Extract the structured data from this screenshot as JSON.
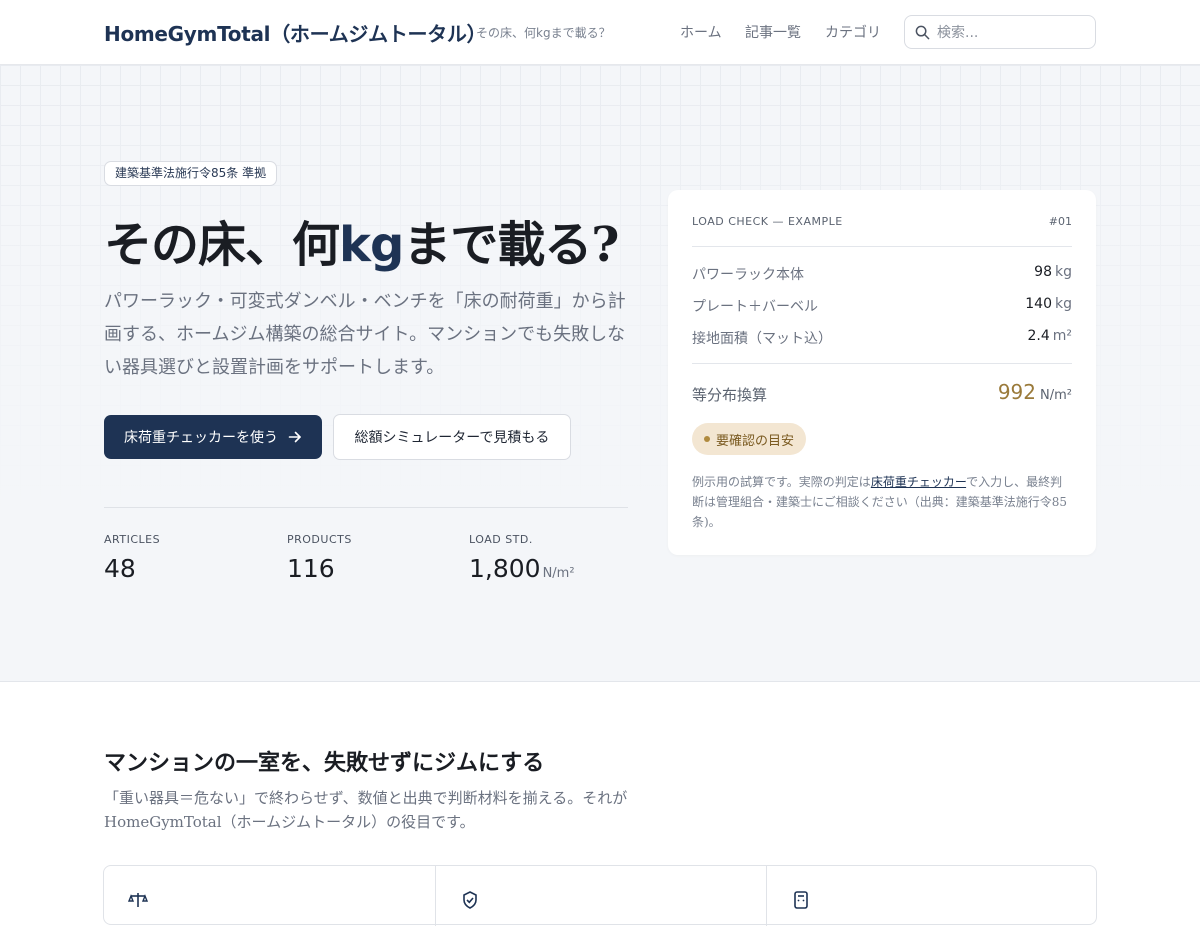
{
  "header": {
    "brand": "HomeGymTotal（ホームジムトータル）",
    "tagline": "その床、何kgまで載る？",
    "nav": [
      {
        "label": "ホーム"
      },
      {
        "label": "記事一覧"
      },
      {
        "label": "カテゴリ"
      }
    ],
    "search_placeholder": "検索..."
  },
  "hero": {
    "badge": "建築基準法施行令85条 準拠",
    "headline_pre": "その床、何",
    "headline_accent": "kg",
    "headline_post": "まで載る?",
    "lead": "パワーラック・可変式ダンベル・ベンチを「床の耐荷重」から計画する、ホームジム構築の総合サイト。マンションでも失敗しない器具選びと設置計画をサポートします。",
    "primary_button": "床荷重チェッカーを使う",
    "secondary_button": "総額シミュレーターで見積もる",
    "stats": [
      {
        "label": "ARTICLES",
        "value": "48",
        "unit": ""
      },
      {
        "label": "PRODUCTS",
        "value": "116",
        "unit": ""
      },
      {
        "label": "LOAD STD.",
        "value": "1,800",
        "unit": "N/m²"
      }
    ]
  },
  "card": {
    "header": "LOAD CHECK — EXAMPLE",
    "number": "#01",
    "rows": [
      {
        "label": "パワーラック本体",
        "value": "98",
        "unit": "kg"
      },
      {
        "label": "プレート＋バーベル",
        "value": "140",
        "unit": "kg"
      },
      {
        "label": "接地面積（マット込）",
        "value": "2.4",
        "unit": "m²"
      }
    ],
    "total_label": "等分布換算",
    "total_value": "992",
    "total_unit": "N/m²",
    "status": "要確認の目安",
    "note_pre": "例示用の試算です。実際の判定は",
    "note_link": "床荷重チェッカー",
    "note_post": "で入力し、最終判断は管理組合・建築士にご相談ください（出典：建築基準法施行令85条)。"
  },
  "section": {
    "title": "マンションの一室を、失敗せずにジムにする",
    "description": "「重い器具＝危ない」で終わらせず、数値と出典で判断材料を揃える。それがHomeGymTotal（ホームジムトータル）の役目です。"
  },
  "features": [
    {
      "icon": "scale-icon"
    },
    {
      "icon": "shield-check-icon"
    },
    {
      "icon": "calculator-icon"
    }
  ],
  "colors": {
    "brand": "#1e3354",
    "accent_gold": "#9a7a3a",
    "status_bg": "#f3e6d2"
  }
}
